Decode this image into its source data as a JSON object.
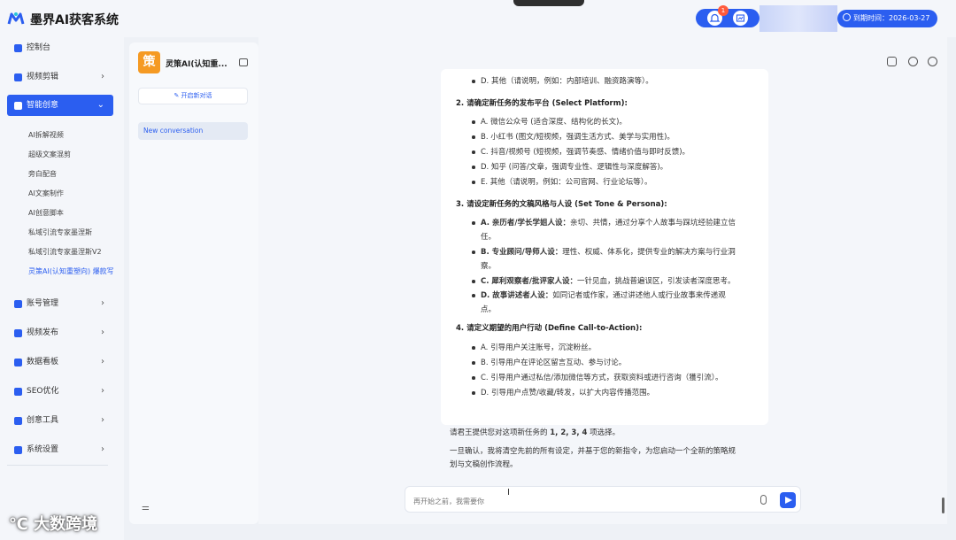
{
  "app": {
    "title": "墨界AI获客系统",
    "expiry": "到期时间：2026-03-27",
    "notification_count": "1"
  },
  "sidebar": {
    "dashboard": "控制台",
    "video_edit": "视频剪辑",
    "smart_creative": "智能创意",
    "sub_items": [
      "AI拆解视频",
      "超级文案混剪",
      "旁白配音",
      "AI文案制作",
      "AI创意脚本",
      "私域引流专家墨涅斯",
      "私域引流专家墨涅斯V2",
      "灵策AI(认知重塑向) 爆款写"
    ],
    "account": "账号管理",
    "publish": "视频发布",
    "data_board": "数据看板",
    "seo": "SEO优化",
    "creative_tools": "创意工具",
    "settings": "系统设置"
  },
  "conversation": {
    "agent_initial": "策",
    "agent_name": "灵策AI(认知重...",
    "new_chat_label": "开启新对话",
    "items": [
      "New conversation"
    ]
  },
  "message": {
    "top_item": "D. 其他（请说明，例如：内部培训、融资路演等）。",
    "section2_title": "2. 请确定新任务的发布平台 (Select Platform):",
    "section2": [
      "A. 微信公众号 (适合深度、结构化的长文)。",
      "B. 小红书 (图文/短视频，强调生活方式、美学与实用性)。",
      "C. 抖音/视频号 (短视频，强调节奏感、情绪价值与即时反馈)。",
      "D. 知乎 (问答/文章，强调专业性、逻辑性与深度解答)。",
      "E. 其他（请说明，例如：公司官网、行业论坛等）。"
    ],
    "section3_title": "3. 请设定新任务的文稿风格与人设 (Set Tone & Persona):",
    "section3": [
      {
        "bold": "A. 亲历者/学长学姐人设：",
        "text": "亲切、共情，通过分享个人故事与踩坑经验建立信",
        "cont": "任。"
      },
      {
        "bold": "B. 专业顾问/导师人设：",
        "text": "理性、权威、体系化，提供专业的解决方案与行业洞",
        "cont": "察。"
      },
      {
        "bold": "C. 犀利观察者/批评家人设：",
        "text": "一针见血，挑战普遍误区，引发读者深度思考。",
        "cont": ""
      },
      {
        "bold": "D. 故事讲述者人设：",
        "text": "如同记者或作家，通过讲述他人或行业故事来传递观",
        "cont": "点。"
      }
    ],
    "section4_title": "4. 请定义期望的用户行动 (Define Call-to-Action):",
    "section4": [
      "A. 引导用户关注账号，沉淀粉丝。",
      "B. 引导用户在评论区留言互动、参与讨论。",
      "C. 引导用户通过私信/添加微信等方式，获取资料或进行咨询（獲引流）。",
      "D. 引导用户点赞/收藏/转发，以扩大内容传播范围。"
    ],
    "prompt_pre": "请君王提供您对这项新任务的 ",
    "prompt_bold": "1, 2, 3, 4",
    "prompt_post": " 项选择。",
    "confirm_1": "一旦确认，我将清空先前的所有设定，并基于您的新指令，为您启动一个全新的策略规",
    "confirm_2": "划与文稿创作流程。"
  },
  "input": {
    "placeholder": "再开始之前，我需要你"
  },
  "watermark": "大数跨境"
}
